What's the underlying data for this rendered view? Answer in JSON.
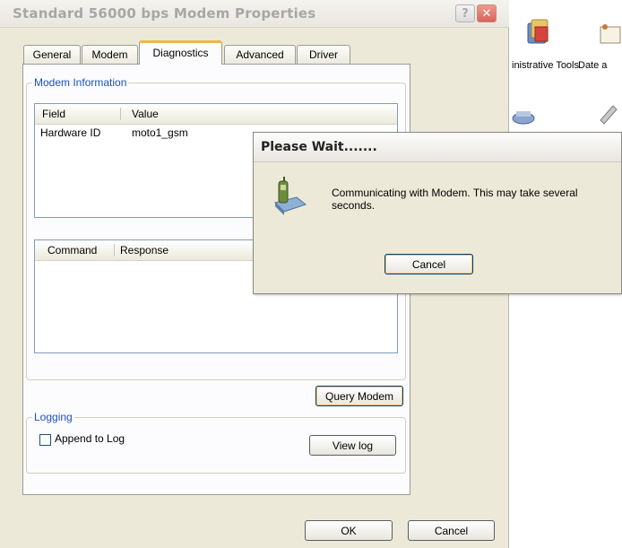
{
  "window": {
    "title": "Standard 56000 bps Modem Properties",
    "help_symbol": "?",
    "close_symbol": "✕"
  },
  "tabs": [
    {
      "label": "General"
    },
    {
      "label": "Modem"
    },
    {
      "label": "Diagnostics",
      "active": true
    },
    {
      "label": "Advanced"
    },
    {
      "label": "Driver"
    }
  ],
  "modem_info": {
    "group_label": "Modem Information",
    "columns": [
      "Field",
      "Value"
    ],
    "rows": [
      {
        "field": "Hardware ID",
        "value": "moto1_gsm"
      }
    ]
  },
  "commands": {
    "columns": [
      "Command",
      "Response"
    ]
  },
  "query_button": "Query Modem",
  "logging": {
    "group_label": "Logging",
    "checkbox_label": "Append to Log",
    "checked": false,
    "view_button": "View log"
  },
  "footer": {
    "ok": "OK",
    "cancel": "Cancel"
  },
  "dialog": {
    "title": "Please Wait.......",
    "message": "Communicating with Modem. This may take several seconds.",
    "cancel": "Cancel"
  },
  "desktop": {
    "labels": [
      "inistrative Tools",
      "Date a"
    ]
  },
  "colors": {
    "window_bg": "#ece9d8",
    "group_label": "#1c4fc1",
    "active_tab_accent": "#f1b64a",
    "close_button": "#d8645a"
  }
}
